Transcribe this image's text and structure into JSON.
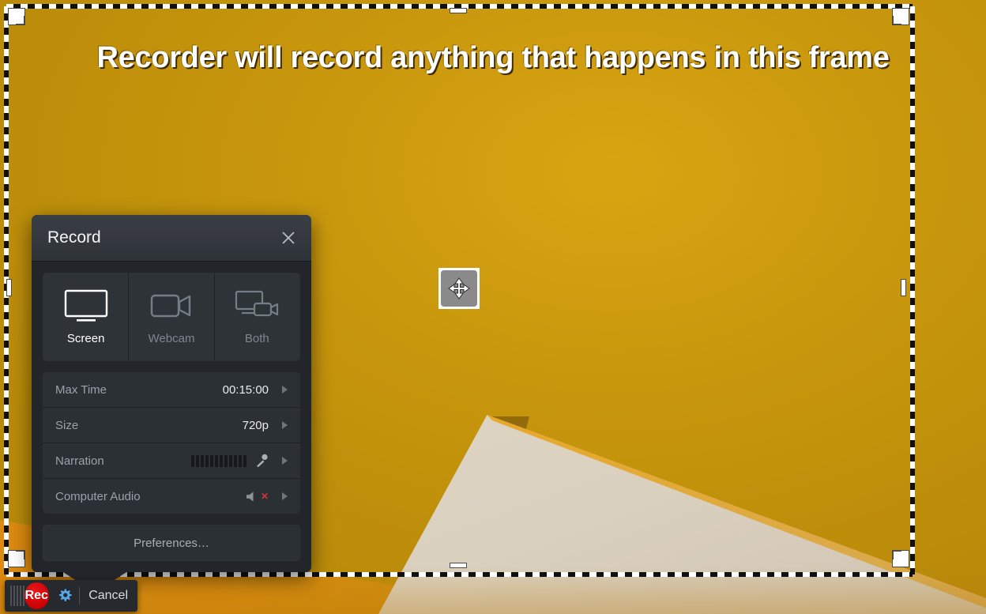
{
  "banner": {
    "text": "Recorder will record anything that happens in this frame"
  },
  "record_panel": {
    "title": "Record",
    "close_label": "close-icon",
    "modes": [
      {
        "label": "Screen",
        "icon": "monitor-icon",
        "active": true
      },
      {
        "label": "Webcam",
        "icon": "camcorder-icon",
        "active": false
      },
      {
        "label": "Both",
        "icon": "monitor-and-camcorder-icon",
        "active": false
      }
    ],
    "settings": [
      {
        "label": "Max Time",
        "value": "00:15:00",
        "kind": "text"
      },
      {
        "label": "Size",
        "value": "720p",
        "kind": "text"
      },
      {
        "label": "Narration",
        "value": "",
        "kind": "meter-mic",
        "meter_bars": 12
      },
      {
        "label": "Computer Audio",
        "value": "",
        "kind": "speaker-muted"
      }
    ],
    "preferences_label": "Preferences…"
  },
  "bottom_bar": {
    "grip": "drag-grip",
    "record_label": "Rec",
    "settings_icon": "gear-icon",
    "cancel_label": "Cancel"
  },
  "selection": {
    "move_handle": "move-handle-icon",
    "corner_handles": [
      "top-left",
      "top-right",
      "bottom-left",
      "bottom-right"
    ],
    "edge_handles": [
      "top",
      "bottom",
      "left",
      "right"
    ]
  },
  "colors": {
    "wallpaper": "#c8970c",
    "wallpaper_shape": "#ded5c4",
    "panel_bg": "#22262a",
    "panel_header": "#343a40",
    "record_red": "#cc0004",
    "gear_blue": "#56a8e8",
    "mute_red": "#d83232",
    "ant_white": "#ffffff",
    "ant_black": "#101010"
  }
}
